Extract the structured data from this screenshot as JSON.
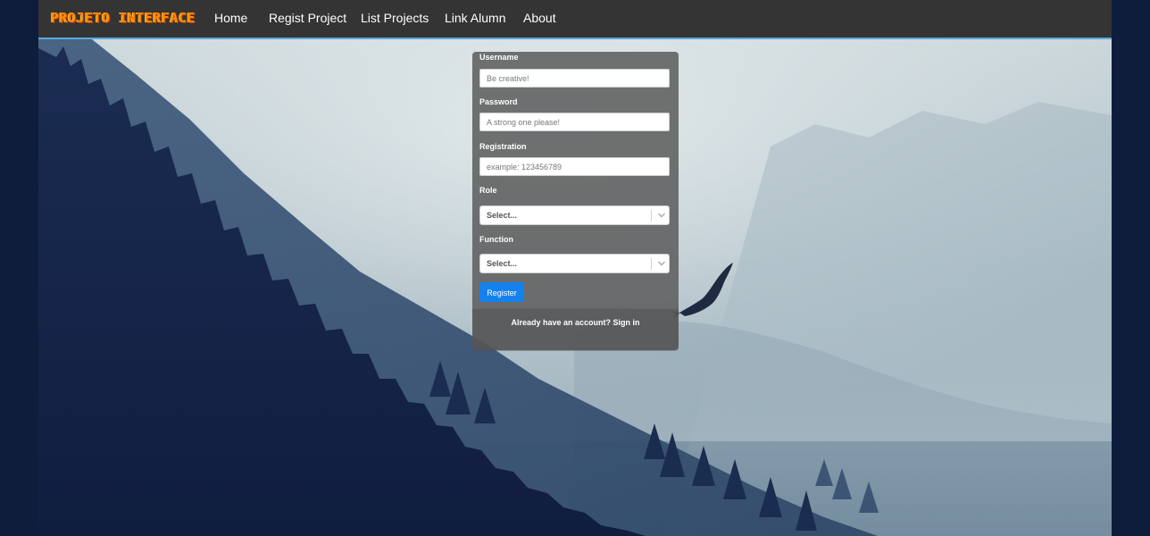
{
  "navbar": {
    "brand": "PROJETO INTERFACE",
    "links": [
      "Home",
      "Regist Project",
      "List Projects",
      "Link Alumn",
      "About"
    ]
  },
  "form": {
    "username": {
      "label": "Username",
      "placeholder": "Be creative!"
    },
    "password": {
      "label": "Password",
      "placeholder": "A strong one please!"
    },
    "registration": {
      "label": "Registration",
      "placeholder": "example: 123456789"
    },
    "role": {
      "label": "Role",
      "value": "Select..."
    },
    "function": {
      "label": "Function",
      "value": "Select..."
    },
    "register_label": "Register",
    "footer_text": "Already have an account?",
    "signin_label": "Sign in"
  },
  "colors": {
    "navbar": "#343434",
    "brand": "#ff8a00",
    "accent_line": "#5aa9dd",
    "button": "#1481ef",
    "page_bg": "#0f1d3d"
  },
  "icons": {
    "select_chevron": "chevron-down-icon"
  }
}
